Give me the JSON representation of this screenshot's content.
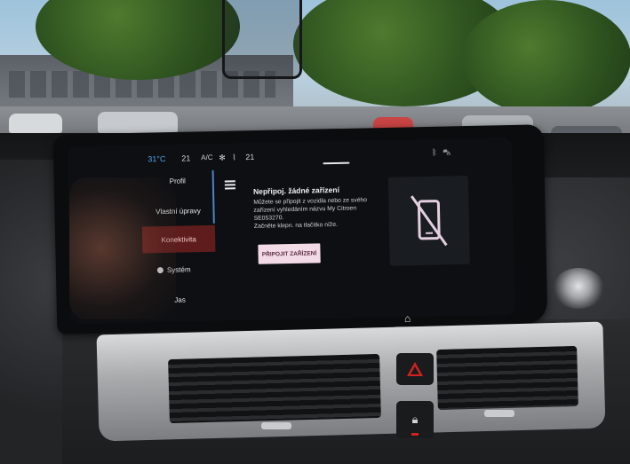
{
  "status_bar": {
    "temp_left": "31°C",
    "temp_left_color": "#4fa3e6",
    "value_1": "21",
    "ac_label": "A/C",
    "fan_icon": "fan-icon",
    "seat_icon": "seat-heat-icon",
    "value_2": "21",
    "bluetooth_icon": "bluetooth-icon",
    "car_icon": "car-icon"
  },
  "side_menu": {
    "items": [
      {
        "label": "Profil"
      },
      {
        "label": "Vlastní úpravy"
      },
      {
        "label": "Konektivita",
        "active": true
      },
      {
        "label": "Systém"
      },
      {
        "label": "Jas"
      }
    ],
    "active_color": "#6e1e1e"
  },
  "menu_icon": "hamburger-menu-icon",
  "message": {
    "title": "Nepřipoj. žádné zařízení",
    "body": "Můžete se připojit z vozidla nebo ze svého zařízení vyhledáním názvu My Citroen SE053270.",
    "hint": "Začněte klepn. na tlačítko níže.",
    "button_label": "PŘIPOJIT ZAŘÍZENÍ",
    "button_color": "#f3dbe6"
  },
  "phone_panel": {
    "icon": "phone-disconnected-icon"
  },
  "hardware": {
    "home_icon": "home-icon",
    "car_icon": "car-icon",
    "hazard_icon": "hazard-icon",
    "lock_icon": "lock-icon",
    "knob": "volume-knob"
  }
}
